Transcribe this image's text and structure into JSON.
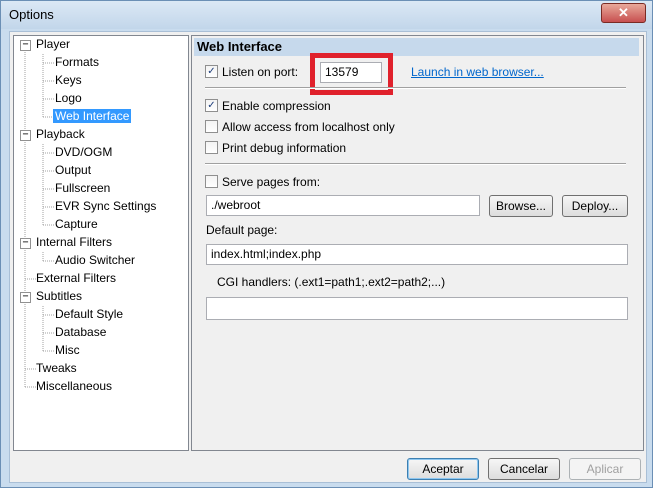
{
  "window": {
    "title": "Options",
    "close_glyph": "✕"
  },
  "tree": {
    "items": [
      {
        "label": "Player",
        "expander": "−"
      },
      {
        "label": "Formats"
      },
      {
        "label": "Keys"
      },
      {
        "label": "Logo"
      },
      {
        "label": "Web Interface",
        "selected": true
      },
      {
        "label": "Playback",
        "expander": "−"
      },
      {
        "label": "DVD/OGM"
      },
      {
        "label": "Output"
      },
      {
        "label": "Fullscreen"
      },
      {
        "label": "EVR Sync Settings"
      },
      {
        "label": "Capture"
      },
      {
        "label": "Internal Filters",
        "expander": "−"
      },
      {
        "label": "Audio Switcher"
      },
      {
        "label": "External Filters"
      },
      {
        "label": "Subtitles",
        "expander": "−"
      },
      {
        "label": "Default Style"
      },
      {
        "label": "Database"
      },
      {
        "label": "Misc"
      },
      {
        "label": "Tweaks"
      },
      {
        "label": "Miscellaneous"
      }
    ]
  },
  "web": {
    "header": "Web Interface",
    "listen_label": "Listen on port:",
    "listen_checked": true,
    "port_value": "13579",
    "launch_link": "Launch in web browser...",
    "compression_label": "Enable compression",
    "compression_checked": true,
    "localhost_label": "Allow access from localhost only",
    "localhost_checked": false,
    "debug_label": "Print debug information",
    "debug_checked": false,
    "serve_label": "Serve pages from:",
    "serve_checked": false,
    "serve_path": "./webroot",
    "browse_label": "Browse...",
    "deploy_label": "Deploy...",
    "default_page_label": "Default page:",
    "default_page_value": "index.html;index.php",
    "cgi_label": "CGI handlers: (.ext1=path1;.ext2=path2;...)",
    "cgi_value": "",
    "check_glyph": "✓"
  },
  "footer": {
    "ok_label": "Aceptar",
    "cancel_label": "Cancelar",
    "apply_label": "Aplicar"
  },
  "colors": {
    "selection": "#3399ff",
    "highlight_box": "#e0212c",
    "link": "#0066cc"
  }
}
